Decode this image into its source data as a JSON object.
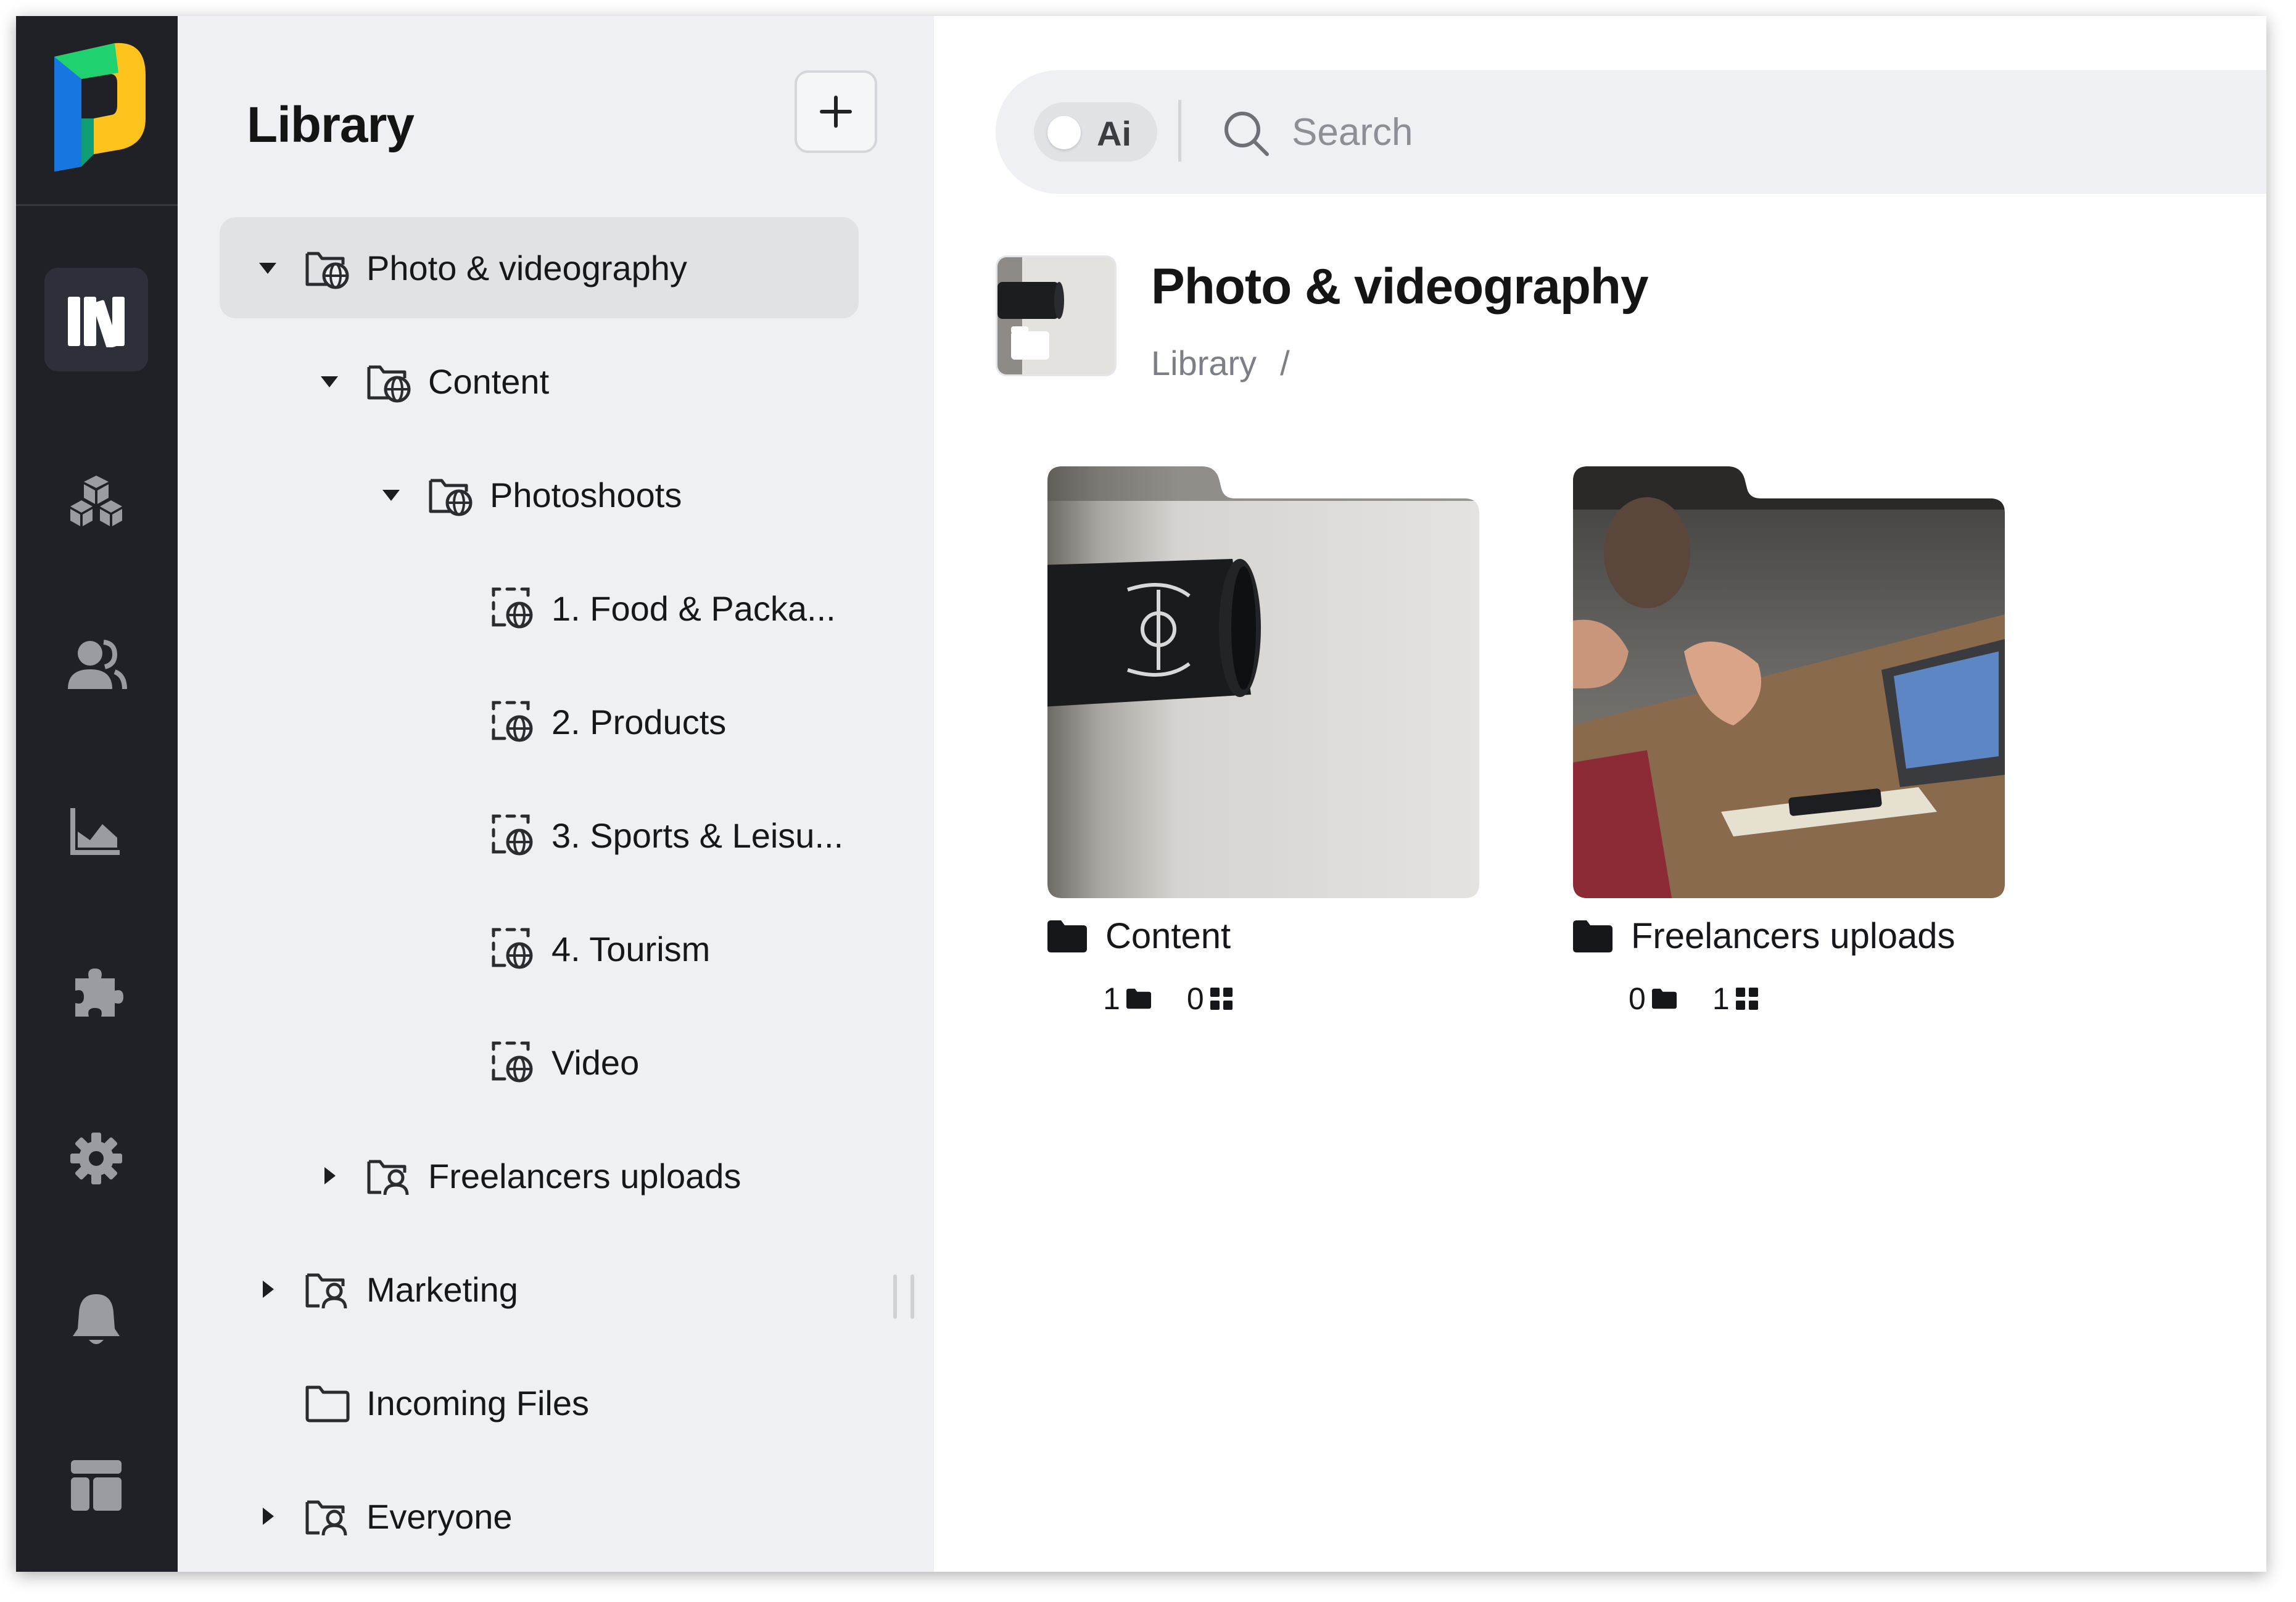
{
  "sidebar": {
    "items": [
      {
        "icon": "library-books-icon",
        "active": true
      },
      {
        "icon": "cubes-icon",
        "active": false
      },
      {
        "icon": "users-icon",
        "active": false
      },
      {
        "icon": "area-chart-icon",
        "active": false
      },
      {
        "icon": "puzzle-icon",
        "active": false
      },
      {
        "icon": "gear-icon",
        "active": false
      },
      {
        "icon": "bell-icon",
        "active": false
      },
      {
        "icon": "layout-icon",
        "active": false
      }
    ]
  },
  "tree": {
    "title": "Library",
    "add_button_icon": "plus-icon",
    "items": [
      {
        "label": "Photo & videography",
        "caret": "down",
        "icon": "shared-folder-icon",
        "selected": true
      },
      {
        "label": "Content",
        "caret": "down",
        "icon": "shared-folder-icon",
        "selected": false
      },
      {
        "label": "Photoshoots",
        "caret": "down",
        "icon": "shared-folder-icon",
        "selected": false
      },
      {
        "label": "1. Food & Packa...",
        "caret": "none",
        "icon": "shared-collection-icon",
        "selected": false
      },
      {
        "label": "2. Products",
        "caret": "none",
        "icon": "shared-collection-icon",
        "selected": false
      },
      {
        "label": "3. Sports & Leisu...",
        "caret": "none",
        "icon": "shared-collection-icon",
        "selected": false
      },
      {
        "label": "4. Tourism",
        "caret": "none",
        "icon": "shared-collection-icon",
        "selected": false
      },
      {
        "label": "Video",
        "caret": "none",
        "icon": "shared-collection-icon",
        "selected": false
      },
      {
        "label": "Freelancers uploads",
        "caret": "right",
        "icon": "user-folder-icon",
        "selected": false
      },
      {
        "label": "Marketing",
        "caret": "right",
        "icon": "user-folder-icon",
        "selected": false
      },
      {
        "label": "Incoming Files",
        "caret": "none",
        "icon": "folder-outline-icon",
        "selected": false
      },
      {
        "label": "Everyone",
        "caret": "right",
        "icon": "user-folder-icon",
        "selected": false
      }
    ]
  },
  "search": {
    "ai_label": "Ai",
    "ai_enabled": false,
    "placeholder": "Search",
    "value": ""
  },
  "main": {
    "title": "Photo & videography",
    "breadcrumb": [
      "Library",
      "/"
    ],
    "cards": [
      {
        "name": "Content",
        "folder_count": "1",
        "asset_count": "0",
        "thumbnail": "coffee-cup-photo"
      },
      {
        "name": "Freelancers uploads",
        "folder_count": "0",
        "asset_count": "1",
        "thumbnail": "meeting-laptop-photo"
      }
    ]
  },
  "colors": {
    "rail": "#1f2127",
    "rail_active": "#2d3038",
    "panel": "#eff0f3",
    "selected_row": "#e0e2e6",
    "logo_green": "#1fd26f",
    "logo_blue": "#1776e0",
    "logo_yellow": "#ffc31e"
  }
}
